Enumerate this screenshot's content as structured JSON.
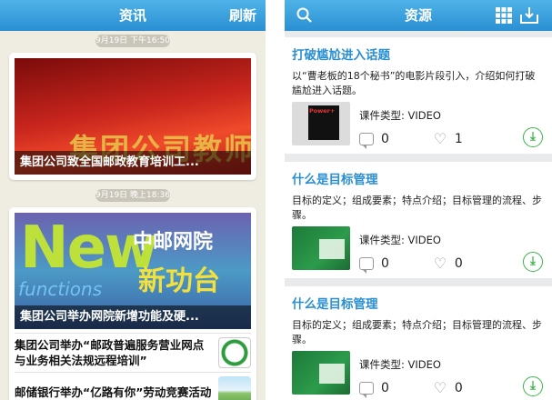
{
  "left_app": {
    "navbar": {
      "title": "资讯",
      "refresh_label": "刷新"
    },
    "groups": [
      {
        "timestamp": "9月19日 下午16:50",
        "banner_caption": "集团公司致全国邮政教育培训工...",
        "banner_art_text": "集团公司教师"
      },
      {
        "timestamp": "9月19日 晚上18:36",
        "banner_caption": "集团公司举办网院新增功能及硬...",
        "banner_art": {
          "big": "New",
          "cn1": "中邮网院",
          "cn2": "新功台",
          "fx": "functions"
        },
        "items": [
          {
            "title": "集团公司举办“邮政普遍服务营业网点与业务相关法规远程培训”",
            "thumb_icon": "epcc-logo-icon"
          },
          {
            "title": "邮储银行举办“亿路有你”劳动竞赛活动",
            "thumb_icon": "road-image-icon"
          }
        ]
      }
    ]
  },
  "right_app": {
    "navbar": {
      "title": "资源",
      "search_icon": "search-icon",
      "grid_icon": "grid-icon",
      "download_icon": "download-tray-icon"
    },
    "courses": [
      {
        "title": "打破尴尬进入话题",
        "description": "以“曹老板的18个秘书”的电影片段引入，介绍如何打破尴尬进入话题。",
        "type_label": "课件类型: VIDEO",
        "comments": "0",
        "likes": "1",
        "thumb_text": "Power+"
      },
      {
        "title": "什么是目标管理",
        "description": "目标的定义；组成要素；特点介绍；目标管理的流程、步骤。",
        "type_label": "课件类型: VIDEO",
        "comments": "0",
        "likes": "0"
      },
      {
        "title": "什么是目标管理",
        "description": "目标的定义；组成要素；特点介绍；目标管理的流程、步骤。",
        "type_label": "课件类型: VIDEO",
        "comments": "0",
        "likes": "0"
      }
    ]
  },
  "colors": {
    "nav_blue": "#2a8fd2",
    "title_blue": "#2a8fd2",
    "download_green": "#3bb54a",
    "left_bg": "#efece1"
  }
}
